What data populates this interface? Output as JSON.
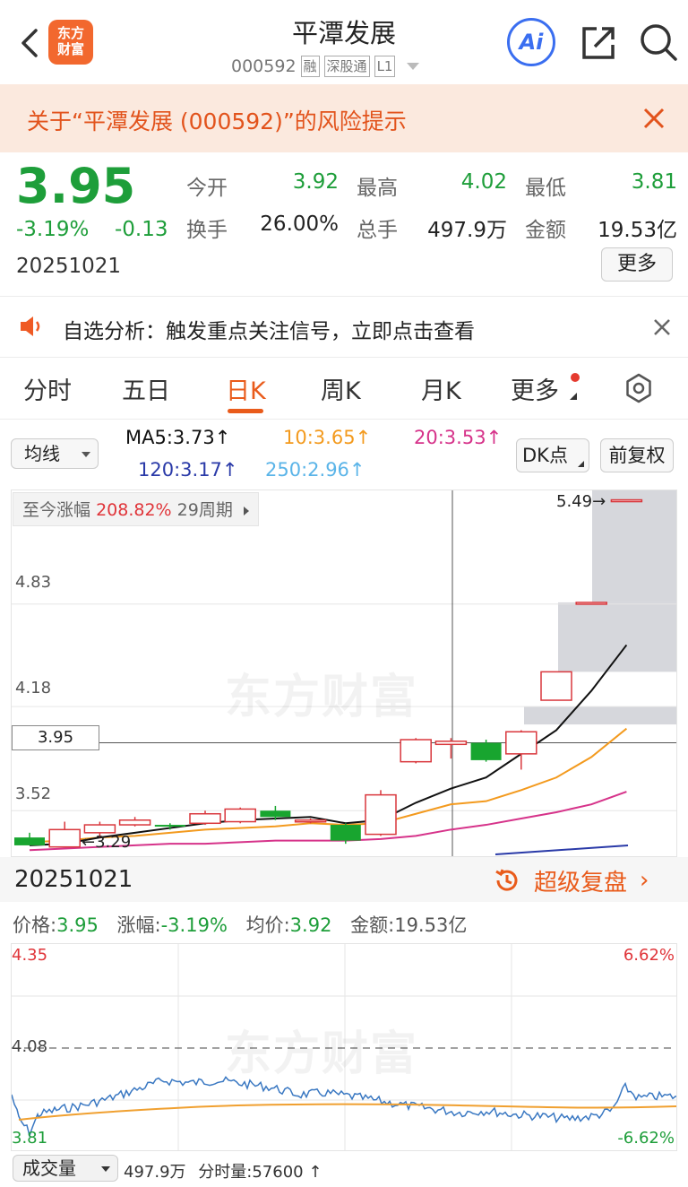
{
  "header": {
    "logo_text_1": "东方",
    "logo_text_2": "财富",
    "title": "平潭发展",
    "code": "000592",
    "badges": [
      "融",
      "深股通",
      "L1"
    ],
    "ai_label": "Ai"
  },
  "risk_banner": {
    "text": "关于“平潭发展 (000592)”的风险提示"
  },
  "quote": {
    "price": "3.95",
    "change_pct": "-3.19%",
    "change": "-0.13",
    "date": "20251021",
    "more_button": "更多",
    "stats": [
      {
        "label": "今开",
        "value": "3.92",
        "color": "green"
      },
      {
        "label": "最高",
        "value": "4.02",
        "color": "green"
      },
      {
        "label": "最低",
        "value": "3.81",
        "color": "green"
      },
      {
        "label": "换手",
        "value": "26.00%",
        "color": "black"
      },
      {
        "label": "总手",
        "value": "497.9万",
        "color": "black"
      },
      {
        "label": "金额",
        "value": "19.53亿",
        "color": "black"
      }
    ]
  },
  "notice": {
    "text": "自选分析：触发重点关注信号，立即点击查看"
  },
  "tabs": [
    "分时",
    "五日",
    "日K",
    "周K",
    "月K",
    "更多"
  ],
  "active_tab": "日K",
  "ma_bar": {
    "ma_select": "均线",
    "ma5": "MA5:3.73",
    "ma10": "10:3.65",
    "ma20": "20:3.53",
    "ma120": "120:3.17",
    "ma250": "250:2.96",
    "dk_button": "DK点",
    "fq_button": "前复权",
    "colors": {
      "ma5": "#111111",
      "ma10": "#f39a1e",
      "ma20": "#d6338a",
      "ma120": "#2a3aa8",
      "ma250": "#5ab4e8"
    }
  },
  "kline": {
    "since_label": "至今涨幅",
    "since_value": "208.82%",
    "since_period": "29周期",
    "y_labels": [
      "4.83",
      "4.18",
      "3.95",
      "3.52"
    ],
    "high_marker": "5.49",
    "low_marker": "3.29",
    "watermark": "东方财富"
  },
  "chart_data": {
    "type": "candlestick",
    "unit": "CNY",
    "candles": [
      {
        "open": 3.35,
        "high": 3.38,
        "low": 3.3,
        "close": 3.3,
        "dir": "down"
      },
      {
        "open": 3.29,
        "high": 3.45,
        "low": 3.29,
        "close": 3.4,
        "dir": "up"
      },
      {
        "open": 3.38,
        "high": 3.45,
        "low": 3.35,
        "close": 3.43,
        "dir": "up"
      },
      {
        "open": 3.43,
        "high": 3.48,
        "low": 3.42,
        "close": 3.46,
        "dir": "up"
      },
      {
        "open": 3.43,
        "high": 3.44,
        "low": 3.4,
        "close": 3.42,
        "dir": "down"
      },
      {
        "open": 3.44,
        "high": 3.52,
        "low": 3.43,
        "close": 3.5,
        "dir": "up"
      },
      {
        "open": 3.45,
        "high": 3.54,
        "low": 3.44,
        "close": 3.53,
        "dir": "up"
      },
      {
        "open": 3.52,
        "high": 3.55,
        "low": 3.46,
        "close": 3.48,
        "dir": "down"
      },
      {
        "open": 3.46,
        "high": 3.47,
        "low": 3.44,
        "close": 3.46,
        "dir": "flat"
      },
      {
        "open": 3.43,
        "high": 3.44,
        "low": 3.31,
        "close": 3.33,
        "dir": "down"
      },
      {
        "open": 3.37,
        "high": 3.65,
        "low": 3.36,
        "close": 3.62,
        "dir": "up"
      },
      {
        "open": 3.83,
        "high": 3.98,
        "low": 3.82,
        "close": 3.97,
        "dir": "up"
      },
      {
        "open": 3.96,
        "high": 3.98,
        "low": 3.85,
        "close": 3.94,
        "dir": "up"
      },
      {
        "open": 3.95,
        "high": 3.97,
        "low": 3.83,
        "close": 3.84,
        "dir": "down"
      },
      {
        "open": 3.88,
        "high": 4.03,
        "low": 3.78,
        "close": 4.02,
        "dir": "up"
      },
      {
        "open": 4.22,
        "high": 4.4,
        "low": 4.22,
        "close": 4.4,
        "dir": "up"
      },
      {
        "open": 4.84,
        "high": 4.84,
        "low": 4.84,
        "close": 4.84,
        "dir": "up"
      },
      {
        "open": 5.49,
        "high": 5.49,
        "low": 5.49,
        "close": 5.49,
        "dir": "up"
      }
    ],
    "ma5": [
      3.3,
      3.31,
      3.35,
      3.38,
      3.41,
      3.44,
      3.46,
      3.47,
      3.48,
      3.44,
      3.46,
      3.57,
      3.66,
      3.73,
      3.88,
      4.03,
      4.28,
      4.57
    ],
    "ma10": [
      3.32,
      3.33,
      3.35,
      3.36,
      3.38,
      3.4,
      3.41,
      3.42,
      3.44,
      3.43,
      3.44,
      3.5,
      3.56,
      3.58,
      3.65,
      3.73,
      3.86,
      4.04
    ],
    "ma20": [
      3.27,
      3.28,
      3.29,
      3.3,
      3.31,
      3.31,
      3.32,
      3.33,
      3.33,
      3.33,
      3.34,
      3.36,
      3.4,
      3.43,
      3.47,
      3.51,
      3.56,
      3.64
    ],
    "ylim": [
      3.22,
      5.55
    ]
  },
  "intraday_header": {
    "date": "20251021",
    "replay": "超级复盘",
    "price": "3.95",
    "pct": "-3.19%",
    "avg": "3.92",
    "amount": "19.53亿",
    "price_label": "价格:",
    "pct_label": "涨幅:",
    "avg_label": "均价:",
    "amount_label": "金额:"
  },
  "intraday": {
    "top_price": "4.35",
    "top_pct": "6.62%",
    "mid_price": "4.08",
    "bottom_price": "3.81",
    "bottom_pct": "-6.62%"
  },
  "volume_bar": {
    "select": "成交量",
    "total": "497.9万",
    "per_label": "分时量:",
    "per_value": "57600"
  }
}
